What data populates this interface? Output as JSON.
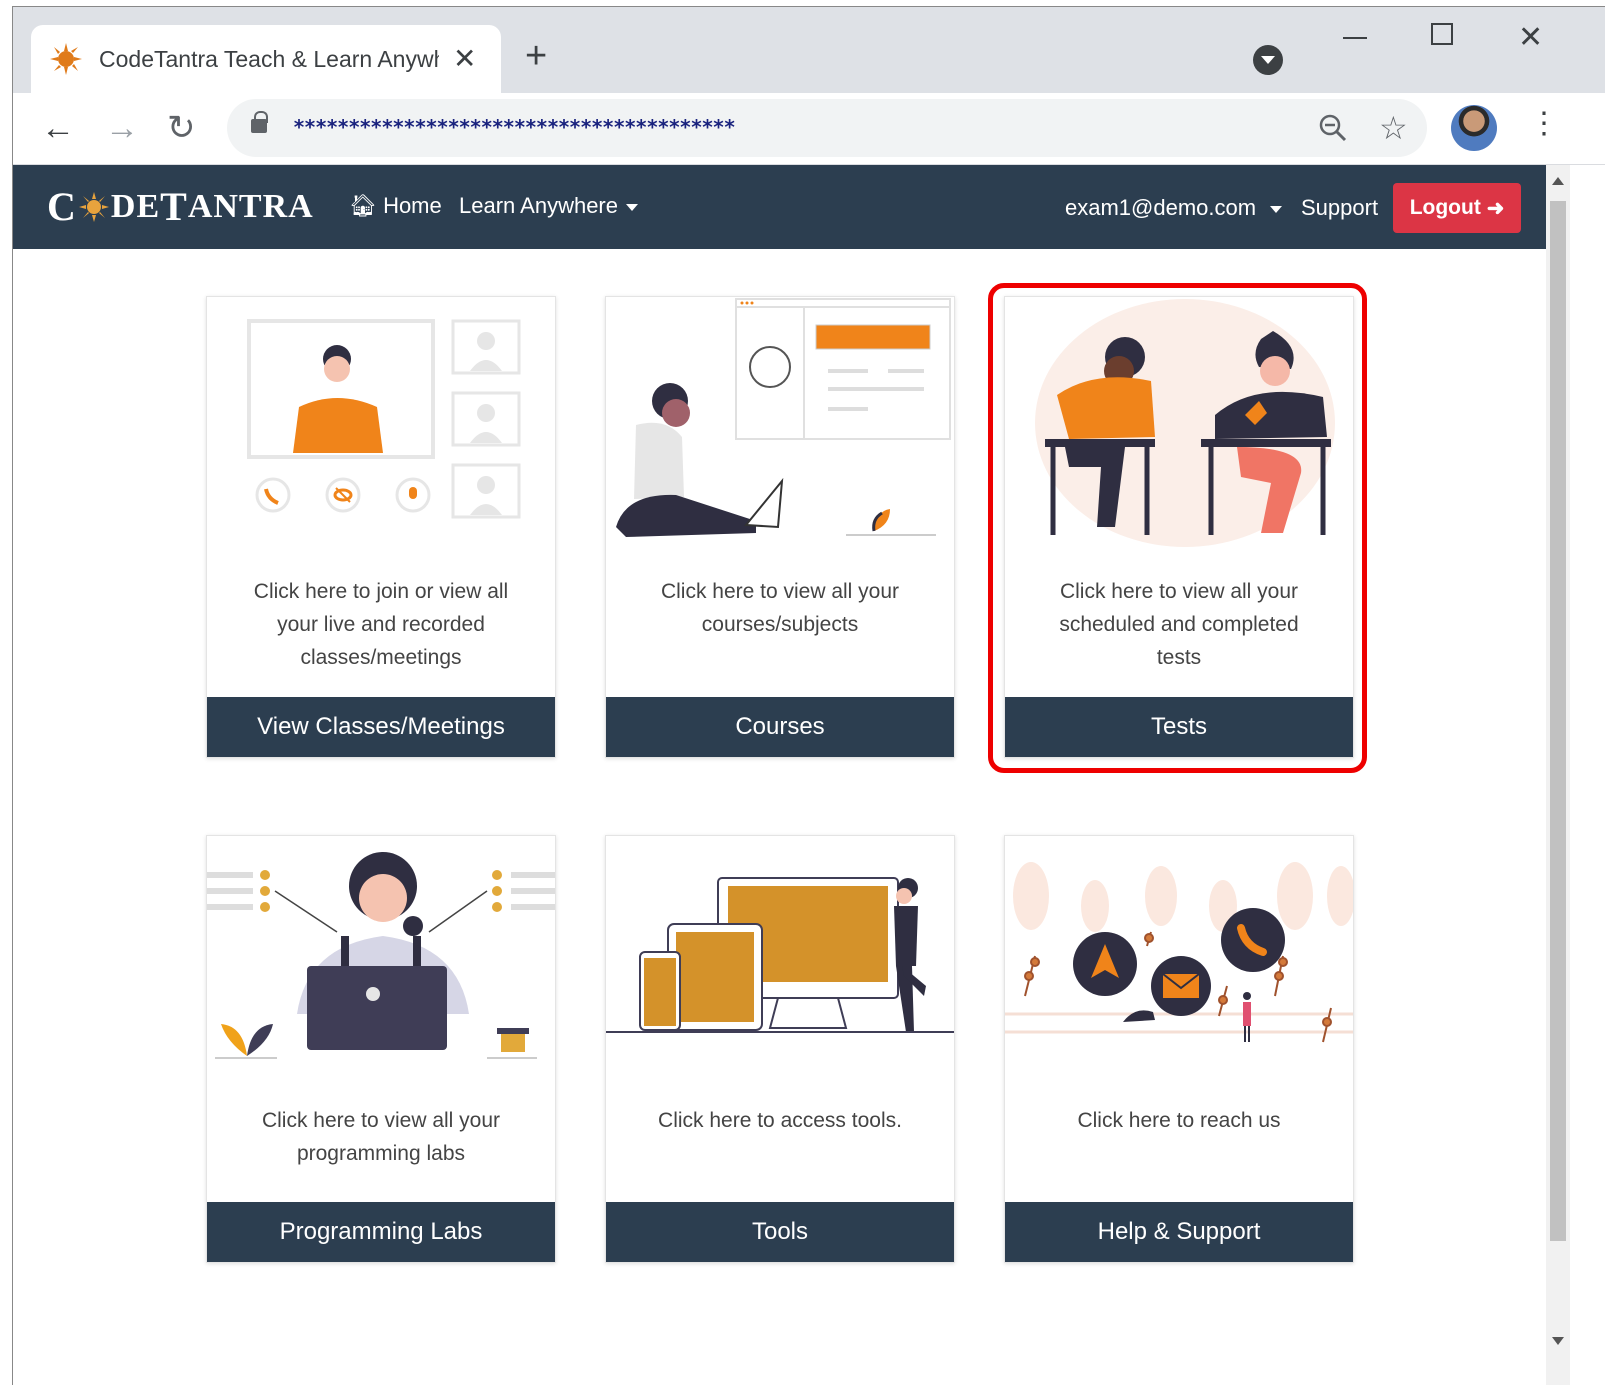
{
  "browser": {
    "tab_title": "CodeTantra Teach & Learn Anywhere",
    "url_masked": "****************************************"
  },
  "navbar": {
    "brand": "CODETANTRA",
    "home": "Home",
    "learn": "Learn Anywhere",
    "user": "exam1@demo.com",
    "support": "Support",
    "logout": "Logout"
  },
  "cards": [
    {
      "text": "Click here to join or view all your live and recorded classes/meetings",
      "button": "View Classes/Meetings"
    },
    {
      "text": "Click here to view all your courses/subjects",
      "button": "Courses"
    },
    {
      "text": "Click here to view all your scheduled and completed tests",
      "button": "Tests"
    },
    {
      "text": "Click here to view all your programming labs",
      "button": "Programming Labs"
    },
    {
      "text": "Click here to access tools.",
      "button": "Tools"
    },
    {
      "text": "Click here to reach us",
      "button": "Help & Support"
    }
  ],
  "colors": {
    "navbar": "#2c3e50",
    "logout": "#dc3545",
    "accent_orange": "#f0841a",
    "highlight": "#ee0000"
  }
}
